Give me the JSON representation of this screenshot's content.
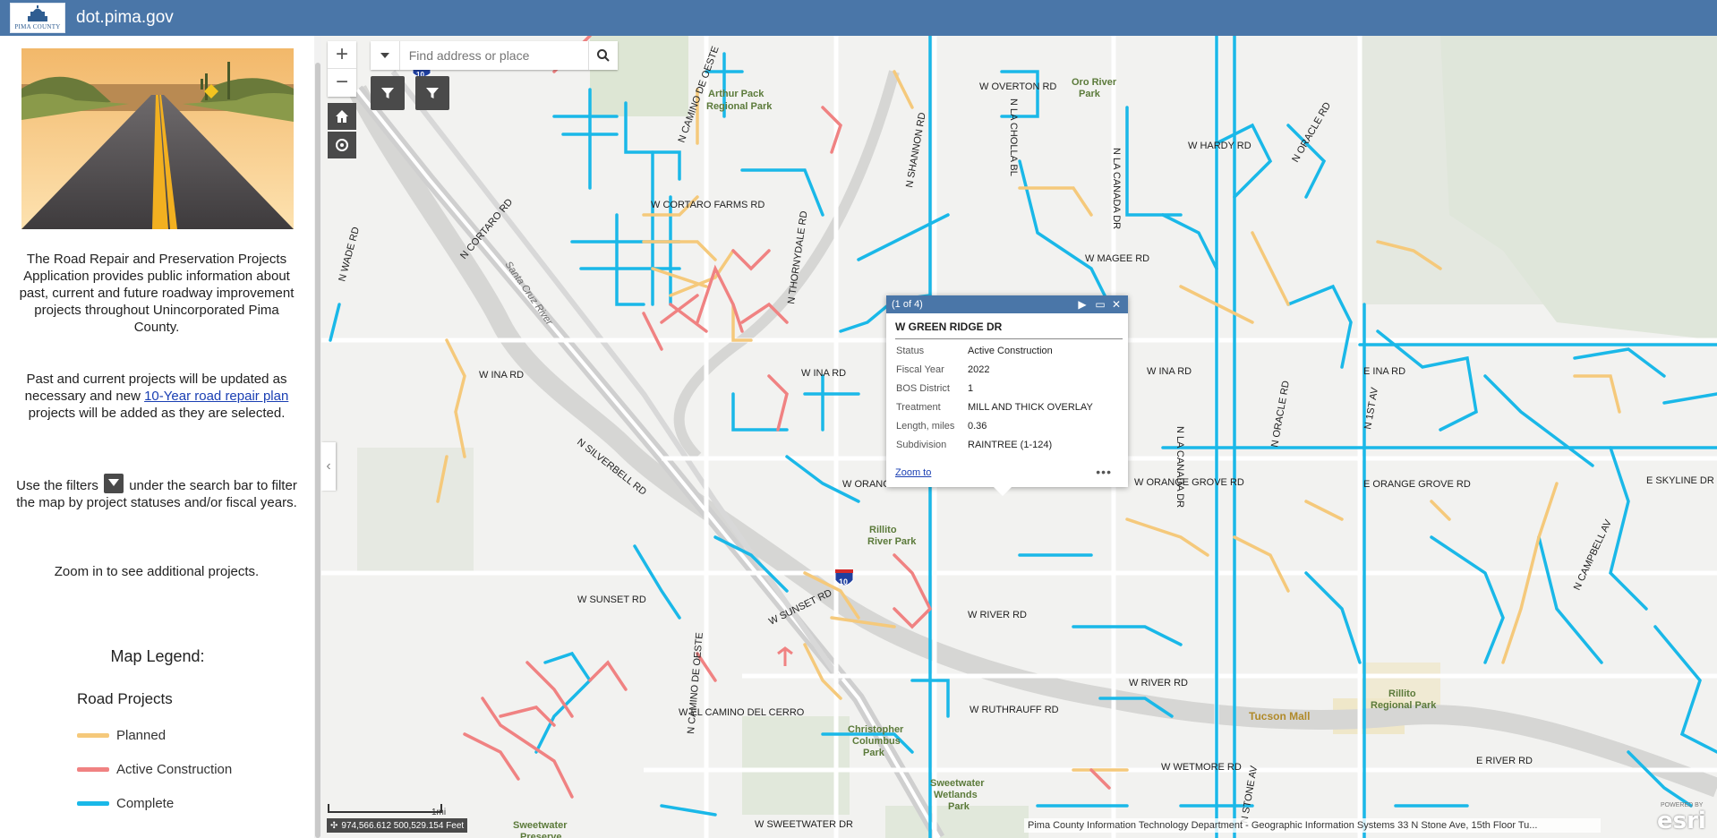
{
  "header": {
    "logo_text": "PIMA COUNTY",
    "title": "dot.pima.gov"
  },
  "sidebar": {
    "intro": "The Road Repair and Preservation Projects Application provides public information about past, current and future roadway improvement projects throughout Unincorporated Pima County.",
    "update_pre": "Past and current projects will be updated as necessary and new ",
    "update_link": "10-Year road repair plan",
    "update_post": " projects will be added as they are selected.",
    "filter_pre": "Use the filters ",
    "filter_post": " under the search bar to filter the map by project statuses and/or fiscal years.",
    "zoom_note": "Zoom in to see additional projects.",
    "legend_title": "Map Legend:",
    "legend_subtitle": "Road Projects",
    "legend_items": [
      {
        "label": "Planned",
        "color": "#f5c97b"
      },
      {
        "label": "Active Construction",
        "color": "#f08282"
      },
      {
        "label": "Complete",
        "color": "#1ab8e8"
      }
    ]
  },
  "map": {
    "zoom_in": "+",
    "zoom_out": "−",
    "search_placeholder": "Find address or place",
    "popup": {
      "counter": "(1 of 4)",
      "title": "W GREEN RIDGE DR",
      "fields": [
        {
          "key": "Status",
          "value": "Active Construction"
        },
        {
          "key": "Fiscal Year",
          "value": "2022"
        },
        {
          "key": "BOS District",
          "value": "1"
        },
        {
          "key": "Treatment",
          "value": "MILL AND THICK OVERLAY"
        },
        {
          "key": "Length, miles",
          "value": "0.36"
        },
        {
          "key": "Subdivision",
          "value": "RAINTREE (1-124)"
        }
      ],
      "zoom_to": "Zoom to",
      "more": "•••"
    },
    "scale_label": "1mi",
    "coordinates": "974,566.612 500,529.154 Feet",
    "attribution": "Pima County Information Technology Department - Geographic Information Systems 33 N Stone Ave, 15th Floor Tu...",
    "esri_powered": "POWERED BY",
    "esri_logo": "esri",
    "road_labels": [
      "W OVERTON RD",
      "W HARDY RD",
      "N ORACLE RD",
      "W CORTARO FARMS RD",
      "N CORTARO RD",
      "N WADE RD",
      "W MAGEE RD",
      "W INA RD",
      "N SILVERBELL RD",
      "W ORANGE GROVE RD",
      "E ORANGE GROVE RD",
      "E SKYLINE DR",
      "W SUNSET RD",
      "W RIVER RD",
      "W EL CAMINO DEL CERRO",
      "W RUTHRAUFF RD",
      "W WETMORE RD",
      "W SWEETWATER DR",
      "N STONE AV",
      "N LA CANADA DR",
      "N LA CHOLLA BL",
      "N SHANNON RD",
      "N CAMINO DE OESTE",
      "N CAMPBELL AV",
      "N LA CANADA DR",
      "E RIVER RD",
      "E INA RD",
      "N 1ST AV",
      "N ORACLE RD",
      "N THORNYDALE RD",
      "N CAMINO DE OESTE"
    ],
    "place_labels": [
      "Arthur Pack Regional Park",
      "Oro River Park",
      "Santa Cruz River",
      "Rillito River Park",
      "Christopher Columbus Park",
      "Sweetwater Wetlands Park",
      "Sweetwater Preserve",
      "Tucson Mall",
      "Rillito Regional Park"
    ],
    "interstate": "10"
  }
}
